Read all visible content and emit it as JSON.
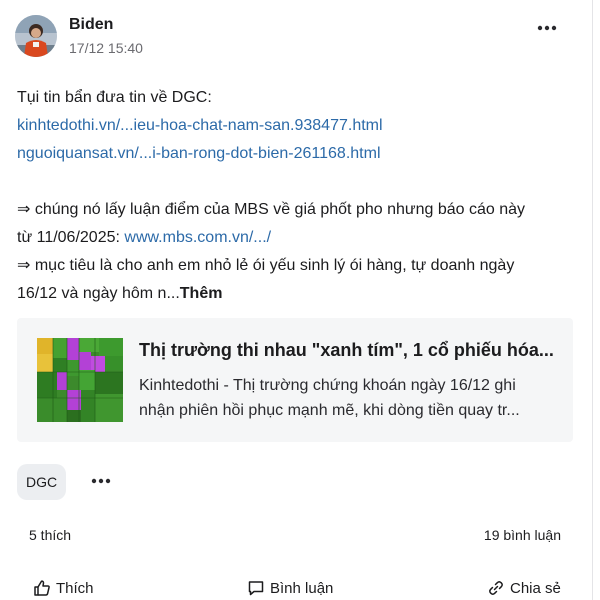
{
  "post": {
    "author": "Biden",
    "time": "17/12 15:40",
    "lines": {
      "l1": "Tụi tin bẩn đưa tin về DGC:",
      "l2": "kinhtedothi.vn/...ieu-hoa-chat-nam-san.938477.html",
      "l3": "nguoiquansat.vn/...i-ban-rong-dot-bien-261168.html",
      "l4": "⇒ chúng nó lấy luận điểm của MBS về giá phốt pho nhưng báo cáo này",
      "l5_text": "từ 11/06/2025: ",
      "l5_link": "www.mbs.com.vn/.../",
      "l6": "⇒ mục tiêu là cho anh em nhỏ lẻ ói yếu sinh lý ói hàng, tự doanh ngày",
      "l7_text": "16/12 và ngày hôm n...",
      "see_more": "Thêm"
    },
    "preview": {
      "title": "Thị trường thi nhau \"xanh tím\", 1 cổ phiếu hóa...",
      "desc_line1": "Kinhtedothi - Thị trường chứng khoán ngày 16/12 ghi",
      "desc_line2": "nhận phiên hồi phục mạnh mẽ, khi dòng tiền quay tr..."
    },
    "tag": "DGC",
    "stats": {
      "likes": "5 thích",
      "comments": "19 bình luận"
    },
    "actions": {
      "like": "Thích",
      "comment": "Bình luận",
      "share": "Chia sẻ"
    }
  },
  "icons": {
    "more": "more-horizontal-icon",
    "like": "thumbs-up-icon",
    "comment": "comment-icon",
    "share": "link-share-icon"
  },
  "colors": {
    "link": "#2c6aa8",
    "preview_bg": "#f5f6f7",
    "tag_bg": "#eceef1",
    "thumb_green": "#3c8a2c",
    "thumb_purple": "#b341d6",
    "thumb_yellow": "#e8c23a"
  }
}
